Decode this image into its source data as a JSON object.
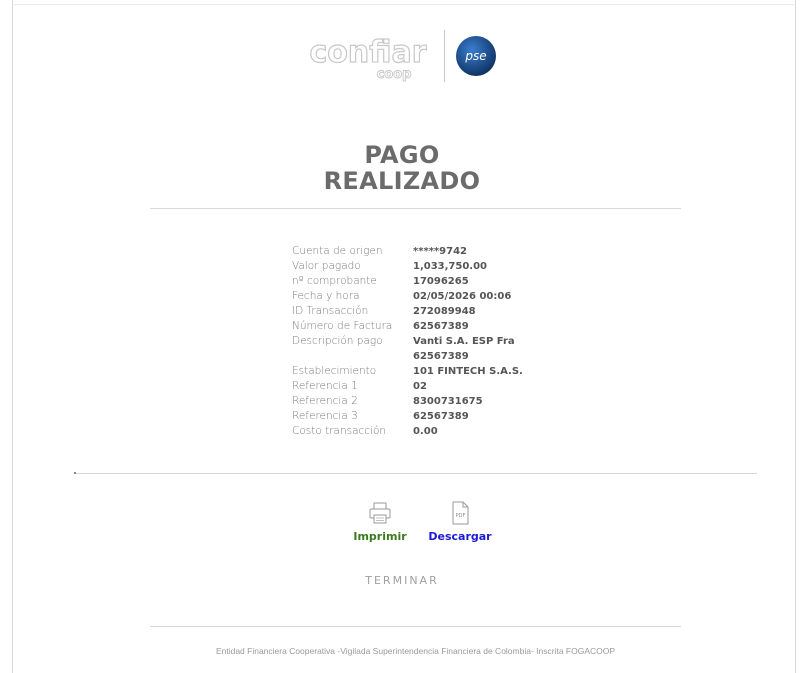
{
  "brand": {
    "confiar_logo_text": "confiar",
    "confiar_logo_sub": "coop",
    "pse_logo_text": "pse",
    "accent_blue": "#1f4f8f",
    "print_color": "#3a7a1e",
    "download_color": "#1a1ad6"
  },
  "title": {
    "line1": "PAGO",
    "line2": "REALIZADO"
  },
  "details": [
    {
      "label": "Cuenta de origen",
      "value": "*****9742"
    },
    {
      "label": "Valor pagado",
      "value": "1,033,750.00"
    },
    {
      "label": "nº comprobante",
      "value": "17096265"
    },
    {
      "label": "Fecha y hora",
      "value": "02/05/2026 00:06"
    },
    {
      "label": "ID Transacción",
      "value": "272089948"
    },
    {
      "label": "Número de Factura",
      "value": "62567389"
    },
    {
      "label": "Descripción pago",
      "value": "Vanti S.A. ESP Fra 62567389"
    },
    {
      "label": "Establecimiento",
      "value": "101 FINTECH S.A.S."
    },
    {
      "label": "Referencia 1",
      "value": "02"
    },
    {
      "label": "Referencia 2",
      "value": "8300731675"
    },
    {
      "label": "Referencia 3",
      "value": "62567389"
    },
    {
      "label": "Costo transacción",
      "value": "0.00"
    }
  ],
  "actions": {
    "print_label": "Imprimir",
    "download_label": "Descargar",
    "pdf_icon_text": "PDF",
    "finish_label": "TERMINAR"
  },
  "footer": {
    "text": "Entidad Financiera Cooperativa -Vigilada Superintendencia Financiera de Colombia- Inscrita FOGACOOP"
  }
}
